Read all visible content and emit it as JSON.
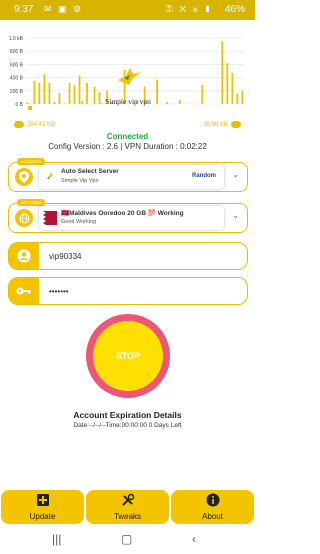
{
  "status_bar": {
    "time": "9:37",
    "left_icons": [
      "notification-icon",
      "image-icon",
      "settings-icon"
    ],
    "right_icons": [
      "vpn-key-icon",
      "mute-icon",
      "wifi-icon",
      "lte-signal-icon"
    ],
    "battery": "46%"
  },
  "chart_data": {
    "type": "bar",
    "ylabels": [
      "1.0 kB",
      "800 B",
      "600 B",
      "400 B",
      "200 B",
      "0 B"
    ],
    "ylim": [
      0,
      1000
    ],
    "grid": true,
    "values": [
      20,
      10,
      0,
      350,
      5,
      320,
      0,
      450,
      0,
      320,
      0,
      30,
      0,
      170,
      0,
      10,
      0,
      320,
      0,
      280,
      0,
      430,
      50,
      0,
      320,
      0,
      0,
      260,
      0,
      180,
      10,
      0,
      200,
      0,
      30,
      0,
      0,
      0,
      0,
      520,
      0,
      0,
      0,
      0,
      50,
      0,
      0,
      260,
      0,
      0,
      0,
      0,
      370,
      0,
      0,
      0,
      30,
      0,
      0,
      0,
      0,
      60,
      0,
      0,
      0,
      0,
      0,
      0,
      0,
      0,
      290,
      0,
      0,
      0,
      0,
      0,
      0,
      0,
      950,
      0,
      620,
      0,
      470,
      0,
      160,
      0,
      200
    ],
    "color": "#e6c200"
  },
  "logo_text": "Simple vip vpn",
  "speeds": {
    "download": "284.43 KB",
    "upload": "35.98 KB"
  },
  "connection": {
    "status": "Connected",
    "config_line": "Config Version : 2.6 | VPN Duration : 0:02:22"
  },
  "server_card": {
    "tag": "LOCATION",
    "title": "Auto Select Server",
    "subtitle": "Simple Vip Vpn",
    "mode": "Random"
  },
  "network_card": {
    "tag": "NETWORK",
    "title": "🇲🇻Maldives Ooredoo 20 GB 💯 Working",
    "subtitle": "Good Working"
  },
  "username": {
    "value": "vip90334"
  },
  "password": {
    "value": "•••••••"
  },
  "stop_button": {
    "label": "STOP"
  },
  "expiration": {
    "title": "Account Expiration Details",
    "detail": "Date:--/--/--Time:00:00:00 0 Days Left"
  },
  "bottom_nav": [
    {
      "label": "Update",
      "icon": "update-icon"
    },
    {
      "label": "Tweaks",
      "icon": "tweaks-icon"
    },
    {
      "label": "About",
      "icon": "info-icon"
    }
  ],
  "colors": {
    "accent": "#f4c400",
    "status_bar": "#d6b400",
    "connected": "#1faa3a",
    "stop_ring": "#ee5577",
    "stop_fill": "#ffe000"
  }
}
